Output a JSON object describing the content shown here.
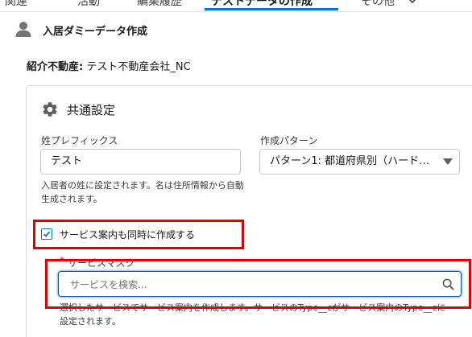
{
  "tabs": [
    {
      "label": "関連",
      "active": false
    },
    {
      "label": "活動",
      "active": false
    },
    {
      "label": "編集履歴",
      "active": false
    },
    {
      "label": "テストデータの作成",
      "active": true
    },
    {
      "label": "その他",
      "active": false
    }
  ],
  "section": {
    "title": "入居ダミーデータ作成",
    "icon": "person-icon"
  },
  "referral": {
    "label": "紹介不動産:",
    "value": "テスト不動産会社_NC"
  },
  "common_settings": {
    "title": "共通設定",
    "icon": "gear-icon",
    "surname_prefix": {
      "label": "姓プレフィックス",
      "value": "テスト",
      "help": "入居者の姓に設定されます。名は住所情報から自動生成されます。"
    },
    "creation_pattern": {
      "label": "作成パターン",
      "selected": "パターン1: 都道府県別（ハード…"
    },
    "create_service_guide": {
      "label": "サービス案内も同時に作成する",
      "checked": true
    },
    "service_mask": {
      "label": "サービスマスク",
      "required_mark": "*",
      "placeholder": "サービスを検索...",
      "help": "選択したサービスでサービス案内を作成します。サービスのType__cがサービス案内のType__cに設定されます。"
    }
  },
  "colors": {
    "accent": "#0176d3",
    "highlight": "#e50000",
    "border": "#c9c9c9"
  }
}
